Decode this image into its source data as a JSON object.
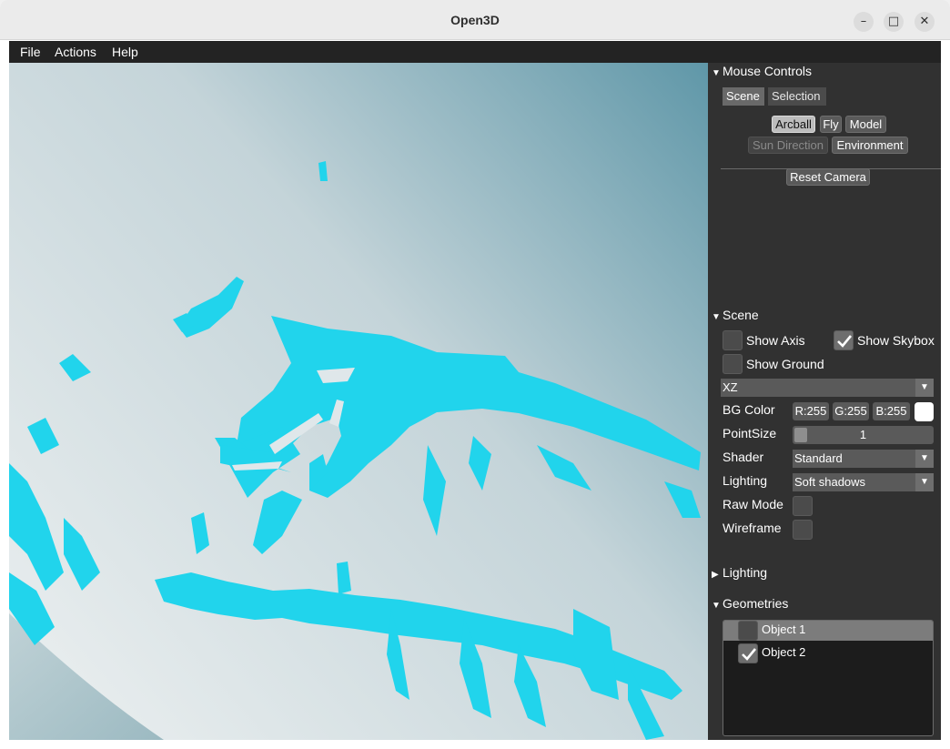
{
  "window": {
    "title": "Open3D",
    "minimize_glyph": "–",
    "maximize_glyph": "□",
    "close_glyph": "✕"
  },
  "menubar": {
    "items": [
      "File",
      "Actions",
      "Help"
    ]
  },
  "viewport": {
    "background_colors": [
      "#e8edee",
      "#c4d4d9",
      "#5f97a8"
    ],
    "pointcloud_color": "#21d4ec"
  },
  "mouse_controls": {
    "header": "Mouse Controls",
    "tabs": [
      "Scene",
      "Selection"
    ],
    "buttons": {
      "arcball": "Arcball",
      "fly": "Fly",
      "model": "Model",
      "sun_direction": "Sun Direction",
      "environment": "Environment",
      "reset_camera": "Reset Camera"
    }
  },
  "scene": {
    "header": "Scene",
    "show_axis": {
      "label": "Show Axis",
      "checked": false
    },
    "show_skybox": {
      "label": "Show Skybox",
      "checked": true
    },
    "show_ground": {
      "label": "Show Ground",
      "checked": false
    },
    "ground_plane": "XZ",
    "bg_color": {
      "label": "BG Color",
      "r": "R:255",
      "g": "G:255",
      "b": "B:255",
      "swatch": "#ffffff"
    },
    "point_size": {
      "label": "PointSize",
      "value": "1"
    },
    "shader": {
      "label": "Shader",
      "value": "Standard"
    },
    "lighting": {
      "label": "Lighting",
      "value": "Soft shadows"
    },
    "raw_mode": {
      "label": "Raw Mode",
      "checked": false
    },
    "wireframe": {
      "label": "Wireframe",
      "checked": false
    }
  },
  "lighting_section": {
    "header": "Lighting"
  },
  "geometries": {
    "header": "Geometries",
    "items": [
      {
        "name": "Object 1",
        "checked": false
      },
      {
        "name": "Object 2",
        "checked": true
      }
    ]
  },
  "icons": {
    "expanded": "triangle-down-icon",
    "collapsed": "triangle-right-icon",
    "check": "checkmark-icon",
    "dropdown": "chevron-down-icon"
  }
}
